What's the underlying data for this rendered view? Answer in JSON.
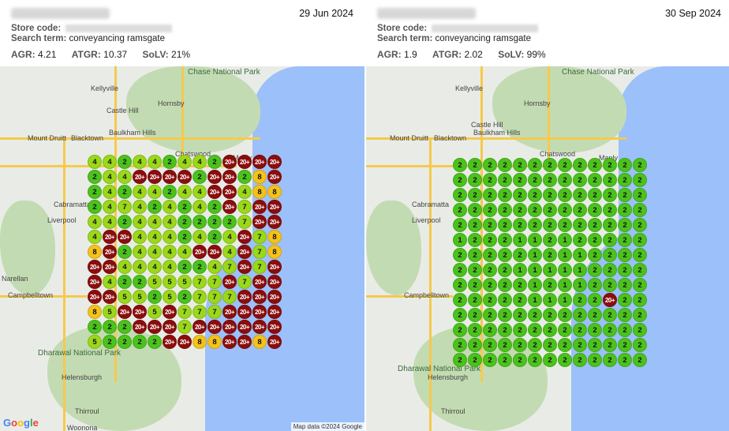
{
  "colors": {
    "green": "#4cc21d",
    "lime": "#9bd81b",
    "yellow": "#f4c21a",
    "maroon": "#8b0d0d",
    "ocean": "#9cc0f9",
    "park": "#c3dbb3"
  },
  "icons": {
    "google_logo": "google-logo"
  },
  "panels": [
    {
      "date": "29 Jun 2024",
      "store_label": "Store code:",
      "search_label": "Search term:",
      "search_value": "conveyancing ramsgate",
      "agr_label": "AGR:",
      "agr_value": "4.21",
      "atgr_label": "ATGR:",
      "atgr_value": "10.37",
      "solv_label": "SoLV:",
      "solv_value": "21%",
      "attribution": "Map data ©2024 Google",
      "places": [
        "Kellyville",
        "Castle Hill",
        "Hornsby",
        "Baulkham Hills",
        "Mount Druitt",
        "Blacktown",
        "Chatswood",
        "Manly",
        "Chase National Park",
        "Liverpool",
        "Cabramatta",
        "Narellan",
        "Campbelltown",
        "Dharawal National Park",
        "Helensburgh",
        "Thirroul",
        "Woonona"
      ],
      "grid": [
        [
          "4",
          "4",
          "2",
          "4",
          "4",
          "2",
          "4",
          "4",
          "2",
          "20+",
          "20+",
          "20+",
          "20+"
        ],
        [
          "2",
          "4",
          "4",
          "20+",
          "20+",
          "20+",
          "20+",
          "2",
          "20+",
          "20+",
          "2",
          "8",
          "20+"
        ],
        [
          "2",
          "4",
          "2",
          "4",
          "4",
          "2",
          "4",
          "4",
          "20+",
          "20+",
          "4",
          "8",
          "8"
        ],
        [
          "2",
          "4",
          "7",
          "4",
          "2",
          "4",
          "2",
          "4",
          "2",
          "20+",
          "7",
          "20+",
          "20+"
        ],
        [
          "4",
          "4",
          "2",
          "4",
          "4",
          "4",
          "2",
          "2",
          "2",
          "2",
          "7",
          "20+",
          "20+"
        ],
        [
          "4",
          "20+",
          "20+",
          "4",
          "4",
          "4",
          "2",
          "4",
          "2",
          "4",
          "20+",
          "7",
          "8"
        ],
        [
          "8",
          "20+",
          "2",
          "4",
          "4",
          "4",
          "4",
          "20+",
          "20+",
          "4",
          "20+",
          "7",
          "8"
        ],
        [
          "20+",
          "20+",
          "4",
          "4",
          "4",
          "4",
          "2",
          "2",
          "4",
          "7",
          "20+",
          "7",
          "20+"
        ],
        [
          "20+",
          "4",
          "2",
          "2",
          "5",
          "5",
          "5",
          "7",
          "7",
          "20+",
          "7",
          "20+",
          "20+"
        ],
        [
          "20+",
          "20+",
          "5",
          "5",
          "2",
          "5",
          "2",
          "7",
          "7",
          "7",
          "20+",
          "20+",
          "20+"
        ],
        [
          "8",
          "5",
          "20+",
          "20+",
          "5",
          "20+",
          "7",
          "7",
          "7",
          "20+",
          "20+",
          "20+",
          "20+"
        ],
        [
          "2",
          "2",
          "2",
          "20+",
          "20+",
          "20+",
          "7",
          "20+",
          "20+",
          "20+",
          "20+",
          "20+",
          "20+"
        ],
        [
          "5",
          "2",
          "2",
          "2",
          "2",
          "20+",
          "20+",
          "8",
          "8",
          "20+",
          "20+",
          "8",
          "20+"
        ]
      ]
    },
    {
      "date": "30 Sep 2024",
      "store_label": "Store code:",
      "search_label": "Search term:",
      "search_value": "conveyancing ramsgate",
      "agr_label": "AGR:",
      "agr_value": "1.9",
      "atgr_label": "ATGR:",
      "atgr_value": "2.02",
      "solv_label": "SoLV:",
      "solv_value": "99%",
      "places": [
        "Kellyville",
        "Castle Hill",
        "Hornsby",
        "Baulkham Hills",
        "Mount Druitt",
        "Blacktown",
        "Chatswood",
        "Manly",
        "Chase National Park",
        "Liverpool",
        "Cabramatta",
        "Campbelltown",
        "Dharawal National Park",
        "Helensburgh",
        "Thirroul"
      ],
      "grid": [
        [
          "2",
          "2",
          "2",
          "2",
          "2",
          "2",
          "2",
          "2",
          "2",
          "2",
          "2",
          "2",
          "2"
        ],
        [
          "2",
          "2",
          "2",
          "2",
          "2",
          "2",
          "2",
          "2",
          "2",
          "2",
          "2",
          "2",
          "2"
        ],
        [
          "2",
          "2",
          "2",
          "2",
          "2",
          "2",
          "2",
          "2",
          "2",
          "2",
          "2",
          "2",
          "2"
        ],
        [
          "2",
          "2",
          "2",
          "2",
          "2",
          "2",
          "2",
          "2",
          "2",
          "2",
          "2",
          "2",
          "2"
        ],
        [
          "2",
          "2",
          "2",
          "2",
          "2",
          "2",
          "2",
          "2",
          "2",
          "2",
          "2",
          "2",
          "2"
        ],
        [
          "1",
          "2",
          "2",
          "2",
          "1",
          "1",
          "2",
          "1",
          "2",
          "2",
          "2",
          "2",
          "2"
        ],
        [
          "2",
          "2",
          "2",
          "2",
          "2",
          "1",
          "2",
          "1",
          "1",
          "2",
          "2",
          "2",
          "2"
        ],
        [
          "2",
          "2",
          "2",
          "2",
          "1",
          "1",
          "1",
          "1",
          "1",
          "2",
          "2",
          "2",
          "2"
        ],
        [
          "2",
          "2",
          "2",
          "2",
          "2",
          "1",
          "2",
          "1",
          "1",
          "2",
          "2",
          "2",
          "2"
        ],
        [
          "2",
          "2",
          "2",
          "2",
          "2",
          "1",
          "1",
          "1",
          "2",
          "2",
          "20+",
          "2",
          "2"
        ],
        [
          "2",
          "2",
          "2",
          "2",
          "2",
          "2",
          "2",
          "2",
          "2",
          "2",
          "2",
          "2",
          "2"
        ],
        [
          "2",
          "2",
          "2",
          "2",
          "2",
          "2",
          "2",
          "2",
          "2",
          "2",
          "2",
          "2",
          "2"
        ],
        [
          "2",
          "2",
          "2",
          "2",
          "2",
          "2",
          "2",
          "2",
          "2",
          "2",
          "2",
          "2",
          "2"
        ],
        [
          "2",
          "2",
          "2",
          "2",
          "2",
          "2",
          "2",
          "2",
          "2",
          "2",
          "2",
          "2",
          "2"
        ]
      ]
    }
  ]
}
